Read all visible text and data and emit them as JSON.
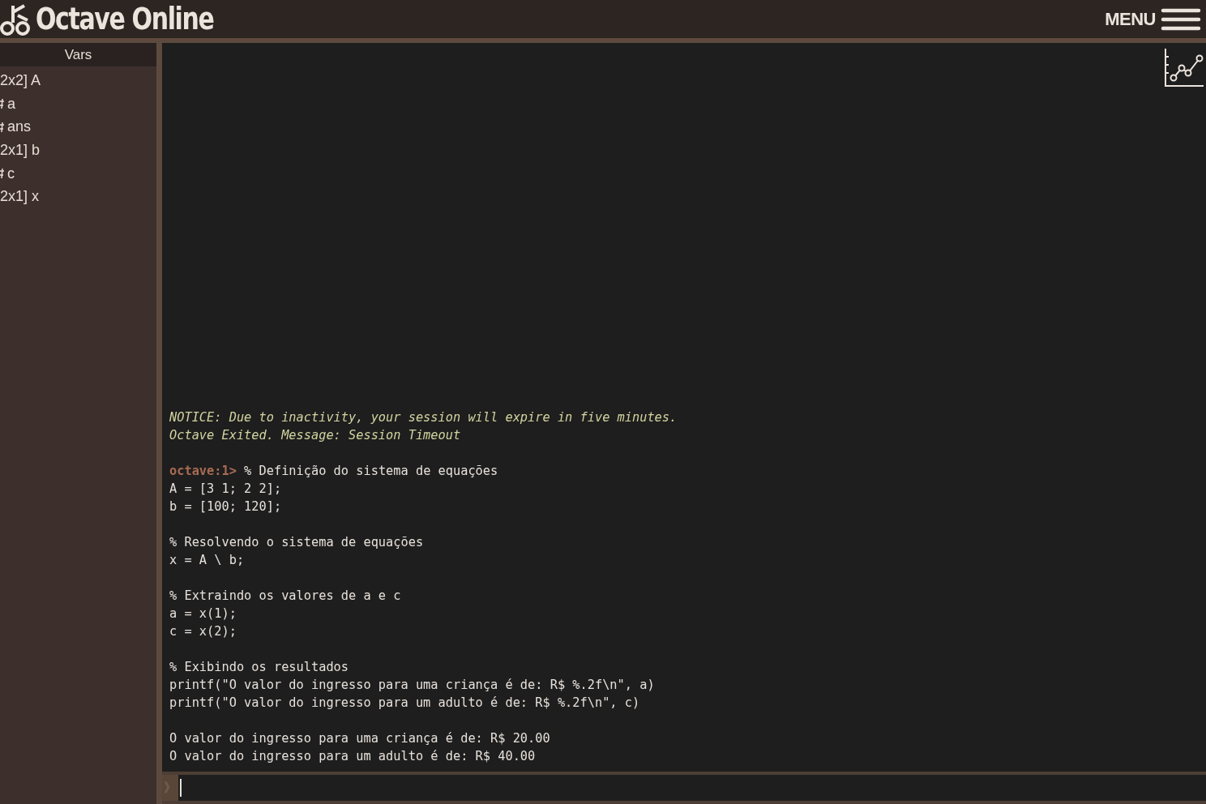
{
  "header": {
    "logo_text": "Octave Online",
    "menu_label": "MENU"
  },
  "sidebar": {
    "title": "Vars",
    "items": [
      {
        "kind": "matrix",
        "label": "2x2] A"
      },
      {
        "kind": "scalar",
        "label": "a"
      },
      {
        "kind": "scalar",
        "label": "ans"
      },
      {
        "kind": "matrix",
        "label": "2x1] b"
      },
      {
        "kind": "scalar",
        "label": "c"
      },
      {
        "kind": "matrix",
        "label": "2x1] x"
      }
    ]
  },
  "console": {
    "notices": [
      "NOTICE: Due to inactivity, your session will expire in five minutes.",
      "Octave Exited. Message: Session Timeout"
    ],
    "prompt": "octave:1>",
    "command_blocks": [
      [
        "% Definição do sistema de equações",
        "A = [3 1; 2 2];",
        "b = [100; 120];"
      ],
      [
        "% Resolvendo o sistema de equações",
        "x = A \\ b;"
      ],
      [
        "% Extraindo os valores de a e c",
        "a = x(1);",
        "c = x(2);"
      ],
      [
        "% Exibindo os resultados",
        "printf(\"O valor do ingresso para uma criança é de: R$ %.2f\\n\", a)",
        "printf(\"O valor do ingresso para um adulto é de: R$ %.2f\\n\", c)"
      ]
    ],
    "output_lines": [
      "O valor do ingresso para uma criança é de: R$ 20.00",
      "O valor do ingresso para um adulto é de: R$ 40.00"
    ],
    "input": {
      "marker": "》"
    }
  }
}
